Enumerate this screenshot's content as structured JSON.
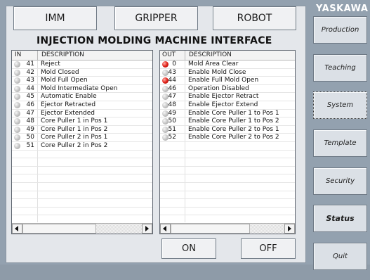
{
  "brand": "YASKAWA",
  "top_tabs": [
    "IMM",
    "GRIPPER",
    "ROBOT"
  ],
  "title": "INJECTION MOLDING MACHINE INTERFACE",
  "input_panel": {
    "col_num": "IN",
    "col_desc": "DESCRIPTION",
    "rows": [
      {
        "num": "41",
        "desc": "Reject",
        "active": false
      },
      {
        "num": "42",
        "desc": "Mold Closed",
        "active": false
      },
      {
        "num": "43",
        "desc": "Mold Full Open",
        "active": false
      },
      {
        "num": "44",
        "desc": "Mold Intermediate Open",
        "active": false
      },
      {
        "num": "45",
        "desc": "Automatic Enable",
        "active": false
      },
      {
        "num": "46",
        "desc": "Ejector Retracted",
        "active": false
      },
      {
        "num": "47",
        "desc": "Ejector Extended",
        "active": false
      },
      {
        "num": "48",
        "desc": "Core Puller 1 in Pos 1",
        "active": false
      },
      {
        "num": "49",
        "desc": "Core Puller 1 in Pos 2",
        "active": false
      },
      {
        "num": "50",
        "desc": "Core Puller 2 in Pos 1",
        "active": false
      },
      {
        "num": "51",
        "desc": "Core Puller 2 in Pos 2",
        "active": false
      }
    ]
  },
  "output_panel": {
    "col_num": "OUT",
    "col_desc": "DESCRIPTION",
    "rows": [
      {
        "num": "0",
        "desc": "Mold Area Clear",
        "active": true
      },
      {
        "num": "43",
        "desc": "Enable Mold Close",
        "active": false
      },
      {
        "num": "44",
        "desc": "Enable Full Mold Open",
        "active": true
      },
      {
        "num": "46",
        "desc": "Operation Disabled",
        "active": false
      },
      {
        "num": "47",
        "desc": "Enable Ejector Retract",
        "active": false
      },
      {
        "num": "48",
        "desc": "Enable Ejector Extend",
        "active": false
      },
      {
        "num": "49",
        "desc": "Enable Core Puller 1 to Pos 1",
        "active": false
      },
      {
        "num": "50",
        "desc": "Enable Core Puller 1 to Pos 2",
        "active": false
      },
      {
        "num": "51",
        "desc": "Enable Core Puller 2 to Pos 1",
        "active": false
      },
      {
        "num": "52",
        "desc": "Enable Core Puller 2 to Pos 2",
        "active": false
      }
    ]
  },
  "action_buttons": {
    "on": "ON",
    "off": "OFF"
  },
  "side_menu": [
    {
      "label": "Production",
      "bold": false,
      "selected": false
    },
    {
      "label": "Teaching",
      "bold": false,
      "selected": false
    },
    {
      "label": "System",
      "bold": false,
      "selected": true
    },
    {
      "label": "Template",
      "bold": false,
      "selected": false
    },
    {
      "label": "Security",
      "bold": false,
      "selected": false
    },
    {
      "label": "Status",
      "bold": true,
      "selected": false
    },
    {
      "label": "Quit",
      "bold": false,
      "selected": false
    }
  ],
  "colors": {
    "led_on": "#e0231b",
    "led_off": "#c2c2c2",
    "background": "#93a1af"
  }
}
